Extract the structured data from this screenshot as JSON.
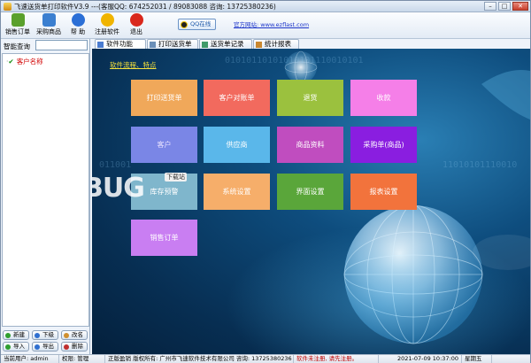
{
  "window": {
    "title": "飞速送货单打印软件V3.9   ---(客服QQ: 674252031 / 89083088 咨询: 13725380236)",
    "min_glyph": "–",
    "max_glyph": "□",
    "close_glyph": "✕"
  },
  "toolbar": {
    "buttons": [
      {
        "label": "销售订单",
        "icon": "cart-icon",
        "color": "#5aa02c"
      },
      {
        "label": "采购商品",
        "icon": "shopping-bag-icon",
        "color": "#3b7fd0"
      },
      {
        "label": "帮 助",
        "icon": "help-icon",
        "color": "#2b6fd6"
      },
      {
        "label": "注册软件",
        "icon": "register-icon",
        "color": "#f0b400"
      },
      {
        "label": "退出",
        "icon": "exit-icon",
        "color": "#d9281c"
      }
    ],
    "qq_label": "QQ在线",
    "site_label": "官方网站: www.ezflast.com"
  },
  "left": {
    "search_label": "智能查询",
    "search_value": "",
    "tree_item_label": "客户名称",
    "buttons": [
      {
        "label": "新建",
        "color": "#2f9f2f"
      },
      {
        "label": "下级",
        "color": "#2f6fd0"
      },
      {
        "label": "改名",
        "color": "#d0902f"
      },
      {
        "label": "导入",
        "color": "#2f9f2f"
      },
      {
        "label": "导出",
        "color": "#2f6fd0"
      },
      {
        "label": "删除",
        "color": "#c02f2f"
      }
    ]
  },
  "tabs": [
    {
      "label": "软件功能",
      "active": true,
      "icon": "feature-icon"
    },
    {
      "label": "打印送货单",
      "active": false,
      "icon": "print-icon"
    },
    {
      "label": "送货单记录",
      "active": false,
      "icon": "record-icon"
    },
    {
      "label": "统计报表",
      "active": false,
      "icon": "report-icon"
    }
  ],
  "main": {
    "feature_link": "软件流程、特点",
    "binary_1": "01010110101010101110010101",
    "binary_2": "011001",
    "binary_3": "11010101110010",
    "watermark": "BUG",
    "watermark_badge": "下载站",
    "tiles": [
      {
        "label": "打印送货单",
        "color": "#f0a85a"
      },
      {
        "label": "客户对账单",
        "color": "#f26a5e"
      },
      {
        "label": "退货",
        "color": "#9bc13e"
      },
      {
        "label": "收款",
        "color": "#f57fe8"
      },
      {
        "label": "客户",
        "color": "#7a86e6"
      },
      {
        "label": "供应商",
        "color": "#5ab7ea"
      },
      {
        "label": "商品资料",
        "color": "#c04dbf"
      },
      {
        "label": "采购单(商品)",
        "color": "#8a1ee0"
      },
      {
        "label": "库存预警",
        "color": "#7fb6cc"
      },
      {
        "label": "系统设置",
        "color": "#f6ae6a"
      },
      {
        "label": "界面设置",
        "color": "#5aa63a"
      },
      {
        "label": "报表设置",
        "color": "#f2733c"
      },
      {
        "label": "销售订单",
        "color": "#c97ef2"
      }
    ]
  },
  "status": {
    "user": "当前用户: admin",
    "role": "权限: 管理",
    "license": "正版盈销  版权所有: 广州市飞速软件技术有限公司  咨询: 13725380236",
    "reg": "软件未注册, 请先注册。",
    "datetime": "2021-07-09 10:37:00",
    "weekday": "星期五"
  }
}
